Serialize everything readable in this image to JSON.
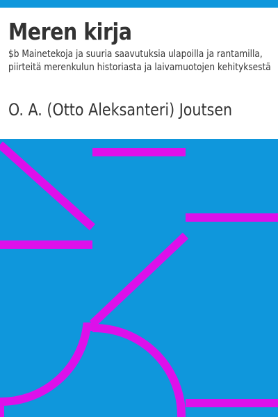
{
  "cover": {
    "title": "Meren kirja",
    "subtitle": "$b Mainetekoja ja suuria saavutuksia ulapoilla ja rantamilla, piirteitä merenkulun historiasta ja laivamuotojen kehityksestä",
    "author": "O. A. (Otto Aleksanteri) Joutsen"
  },
  "colors": {
    "background": "#0f97dc",
    "accent": "#dd10ea",
    "text": "#333333",
    "panel": "#ffffff"
  }
}
